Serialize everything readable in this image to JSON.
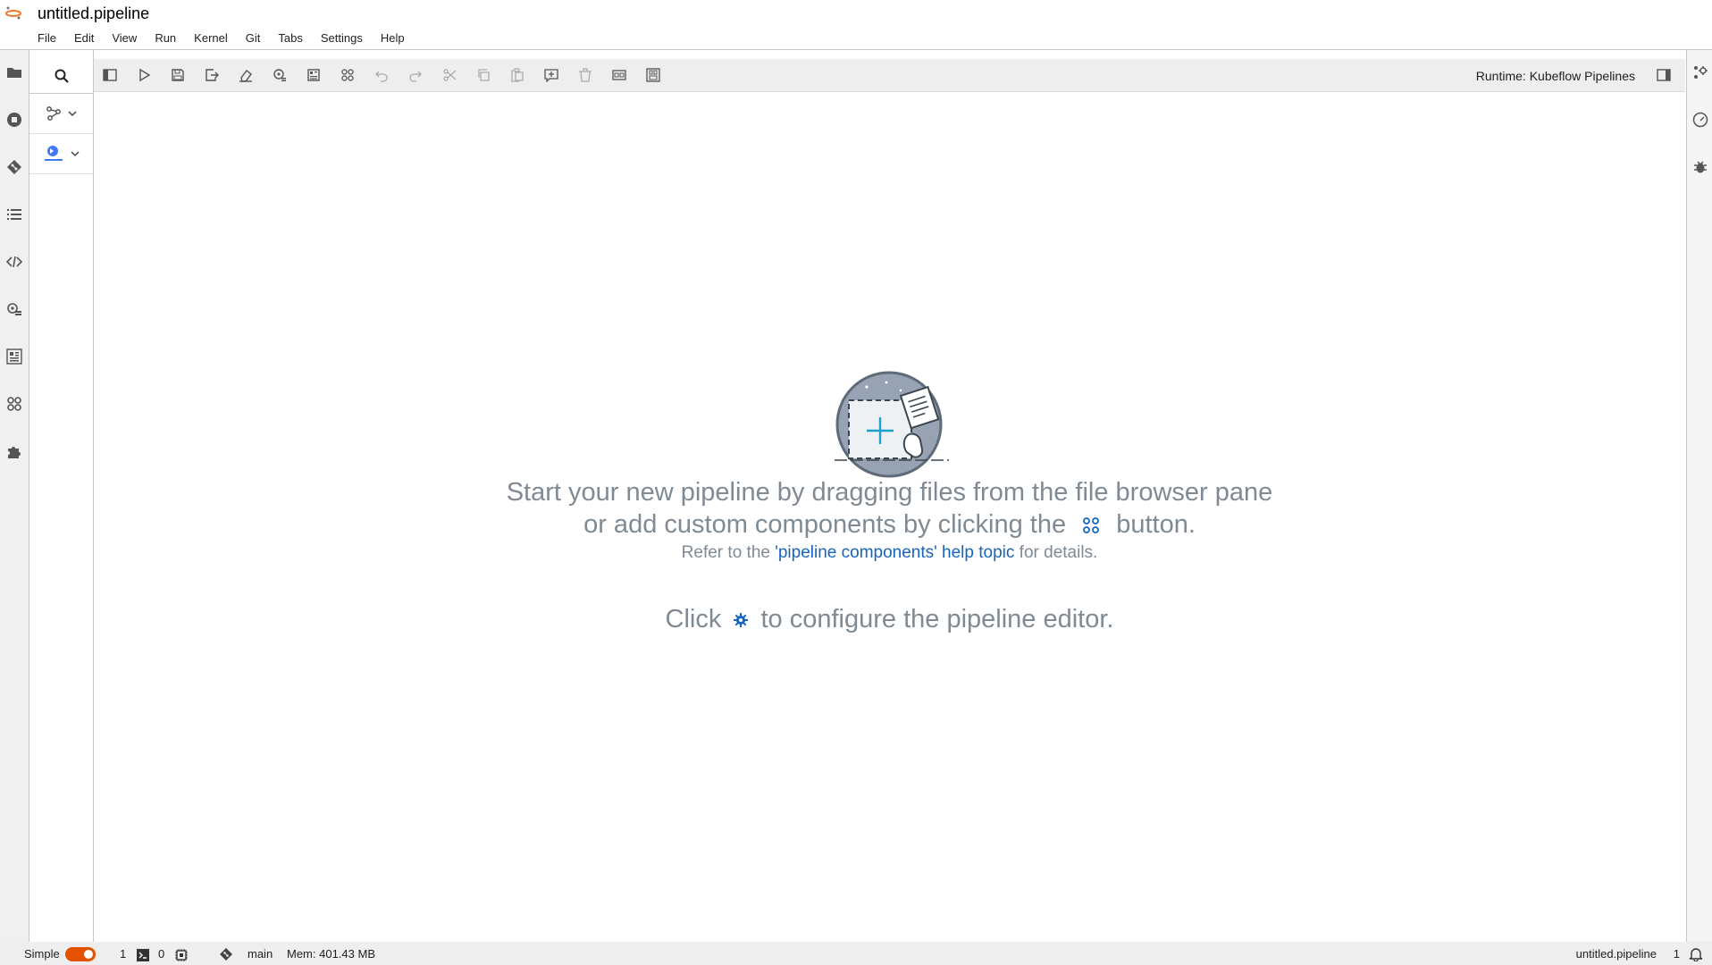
{
  "window": {
    "title": "untitled.pipeline"
  },
  "menu": [
    "File",
    "Edit",
    "View",
    "Run",
    "Kernel",
    "Git",
    "Tabs",
    "Settings",
    "Help"
  ],
  "left_bar_icons": [
    "folder-icon",
    "stop-circle-icon",
    "git-icon",
    "list-icon",
    "code-snippets-icon",
    "runtime-config-icon",
    "component-catalog-icon",
    "pipeline-components-icon",
    "extension-icon"
  ],
  "palette": {
    "categories": [
      "generic-components-icon",
      "kubeflow-logo-icon"
    ]
  },
  "toolbar": {
    "buttons": [
      "open-panel-icon",
      "run-icon",
      "save-icon",
      "export-icon",
      "clear-icon",
      "open-runtimes-icon",
      "open-runtime-images-icon",
      "open-component-catalogs-icon",
      "undo-icon",
      "redo-icon",
      "cut-icon",
      "copy-icon",
      "paste-icon",
      "add-comment-icon",
      "delete-icon",
      "arrange-horizontal-icon",
      "arrange-vertical-icon"
    ],
    "runtime_label": "Runtime: Kubeflow Pipelines"
  },
  "right_bar_icons": [
    "property-inspector-icon",
    "gauge-icon",
    "debugger-icon"
  ],
  "empty_state": {
    "line1": "Start your new pipeline by dragging files from the file browser pane",
    "line2_before": "or add custom components by clicking the",
    "line2_after": "button.",
    "line3_before": "Refer to the",
    "line3_link": "'pipeline components' help topic",
    "line3_after": "for details.",
    "line4_before": "Click",
    "line4_after": "to configure the pipeline editor."
  },
  "status": {
    "mode_label": "Simple",
    "mode_on": true,
    "terminals": "1",
    "kernels": "0",
    "branch": "main",
    "memory": "Mem: 401.43 MB",
    "file_name": "untitled.pipeline",
    "line_number": "1"
  },
  "colors": {
    "accent": "#e65100",
    "link": "#1565c0",
    "empty_text": "#7f8a94",
    "illustration_accent": "#1ba1c9"
  }
}
